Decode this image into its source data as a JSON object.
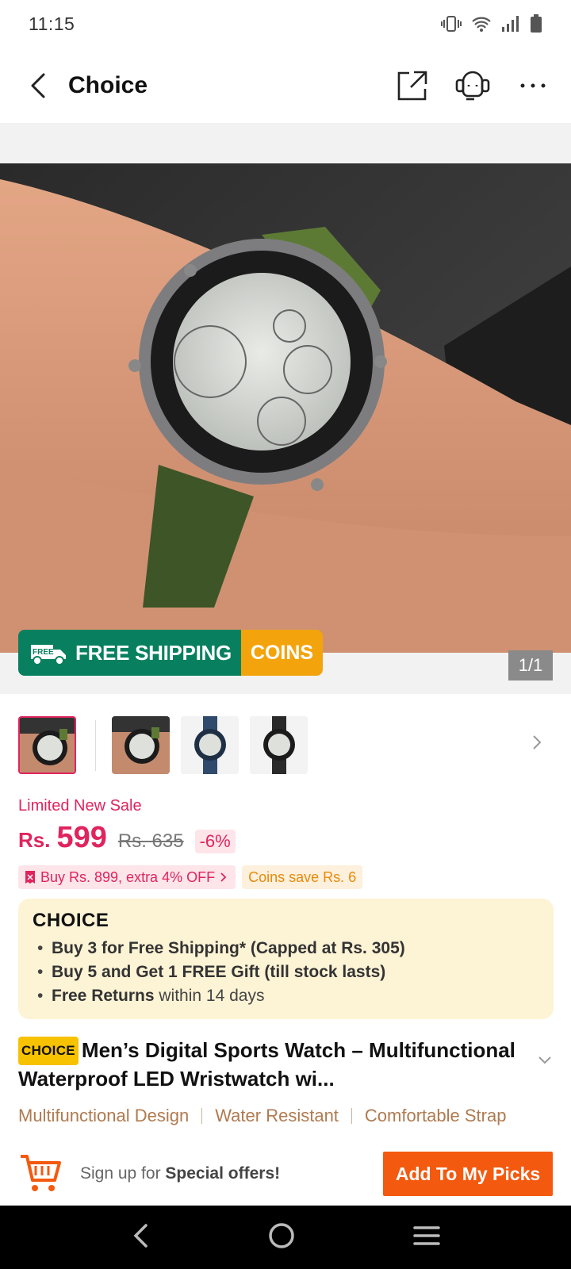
{
  "status_bar": {
    "time": "11:15"
  },
  "nav": {
    "title": "Choice"
  },
  "gallery": {
    "page_counter": "1/1"
  },
  "banner": {
    "free_badge": "FREE",
    "shipping_text": "FREE SHIPPING",
    "coins_text": "COINS"
  },
  "price": {
    "sale_label": "Limited New Sale",
    "currency": "Rs.",
    "current": "599",
    "original": "Rs. 635",
    "discount": "-6%"
  },
  "promos": {
    "bundle": "Buy Rs. 899, extra 4% OFF",
    "coins": "Coins save Rs. 6"
  },
  "choice_card": {
    "logo": "CHOICE",
    "line1": "Buy 3 for  Free Shipping* (Capped at Rs. 305)",
    "line2": "Buy 5 and Get 1 FREE Gift (till stock lasts)",
    "line3_bold": "Free Returns",
    "line3_rest": " within 14 days"
  },
  "product": {
    "badge": "CHOICE",
    "title": "Men’s Digital Sports Watch – Multifunctional Waterproof LED Wristwatch wi..."
  },
  "features": [
    "Multifunctional Design",
    "Water Resistant",
    "Comfortable Strap"
  ],
  "bottom_bar": {
    "signup_prefix": "Sign up for ",
    "signup_bold": "Special offers!",
    "add_button": "Add To My Picks"
  },
  "colors": {
    "accent": "#e0245e",
    "cta": "#f45a0f",
    "shipping": "#08805f",
    "coins": "#f3a40d"
  }
}
